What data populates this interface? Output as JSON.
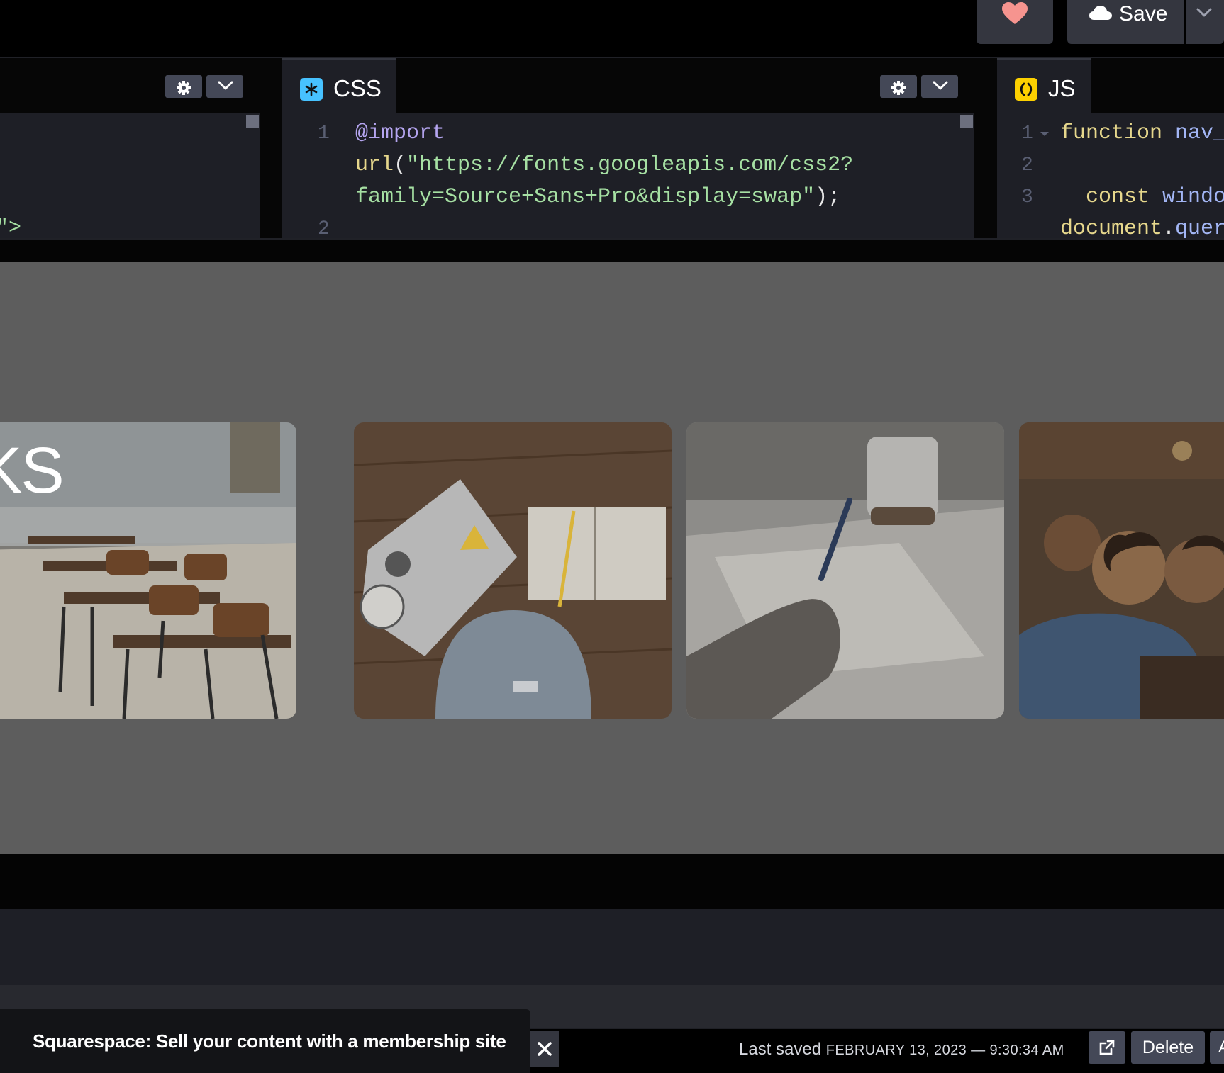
{
  "header": {
    "love_icon": "heart-icon",
    "save_label": "Save",
    "save_icon": "cloud-icon",
    "save_menu_icon": "chevron-down-icon"
  },
  "editors": {
    "html": {
      "partial_code": "\">"
    },
    "css": {
      "tab_label": "CSS",
      "tab_icon": "asterisk-icon",
      "line_numbers": [
        "1",
        "2"
      ],
      "line1": {
        "kw": "@import",
        "fn": "url",
        "open": "(",
        "str1": "\"https://fonts.googleapis.com/css2?",
        "str2": "family=Source+Sans+Pro&display=swap\"",
        "close": ");"
      }
    },
    "js": {
      "tab_label": "JS",
      "tab_icon": "parentheses-icon",
      "line_numbers": [
        "1",
        "2",
        "3"
      ],
      "line1": {
        "kw": "function",
        "name": "nav_"
      },
      "line3": {
        "kw": "const",
        "name": "windo"
      },
      "line3b": {
        "obj": "document",
        "dot": ".",
        "call": "quer"
      }
    }
  },
  "preview": {
    "cards": [
      {
        "name": "classroom",
        "overlay_text": "KS"
      },
      {
        "name": "laptop-backpack"
      },
      {
        "name": "writing-notes"
      },
      {
        "name": "students-studying"
      }
    ]
  },
  "footer": {
    "ad_text": "Squarespace: Sell your content with a membership site",
    "last_saved_label": "Last saved",
    "last_saved_time": "FEBRUARY 13, 2023 — 9:30:34 AM",
    "delete_label": "Delete",
    "edge_label": "A"
  }
}
